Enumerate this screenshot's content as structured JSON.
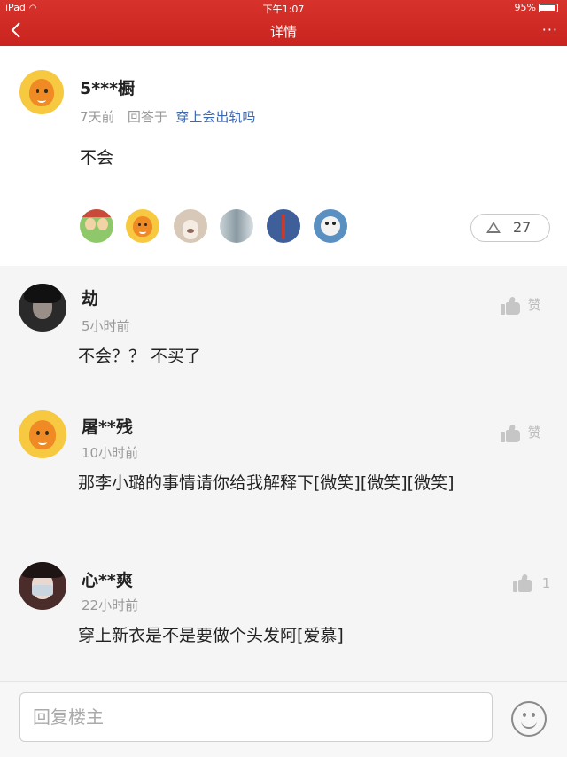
{
  "status_bar": {
    "carrier": "iPad",
    "time": "下午1:07",
    "battery": "95%"
  },
  "nav": {
    "title": "详情",
    "more": "···"
  },
  "main_post": {
    "author": "5***橱",
    "time": "7天前",
    "reply_prefix": "回答于",
    "question_link": "穿上会出轨吗",
    "body": "不会",
    "like_count": "27"
  },
  "comments": [
    {
      "name": "劫",
      "time": "5小时前",
      "text": "不会？？ 不买了",
      "like_label": "赞"
    },
    {
      "name": "屠**残",
      "time": "10小时前",
      "text": "那李小璐的事情请你给我解释下[微笑][微笑][微笑]",
      "like_label": "赞"
    },
    {
      "name": "心**爽",
      "time": "22小时前",
      "text": "穿上新衣是不是要做个头发阿[爱慕]",
      "like_label": "1"
    }
  ],
  "footer": {
    "reply_placeholder": "回复楼主"
  },
  "colors": {
    "header_red": "#d7322b",
    "link_blue": "#3b67b3"
  }
}
